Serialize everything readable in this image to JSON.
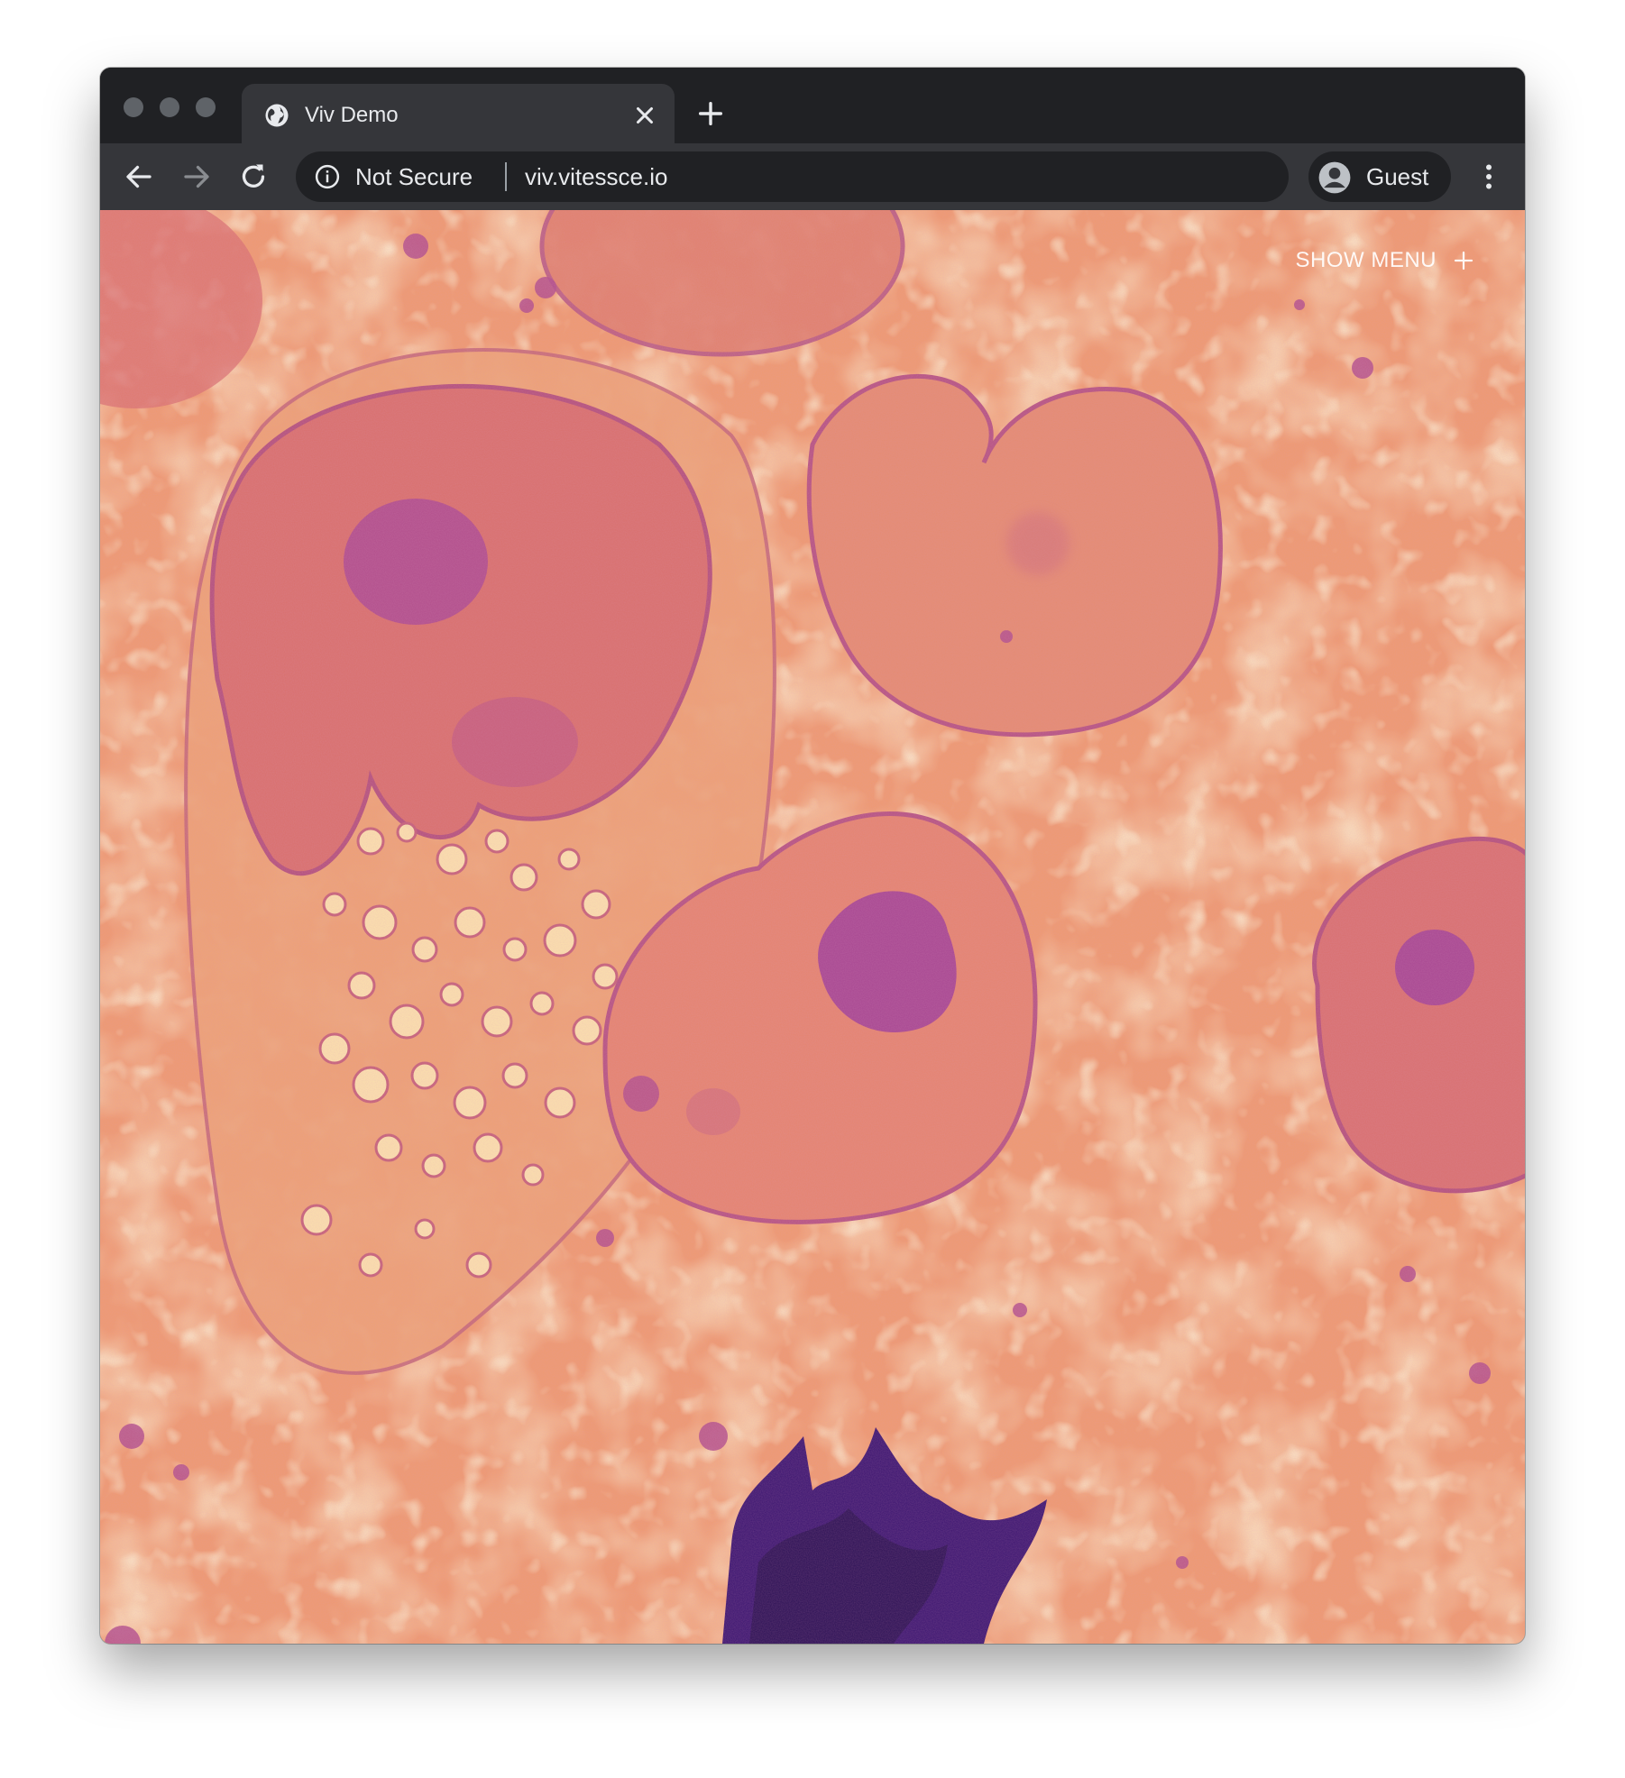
{
  "browser": {
    "tab": {
      "title": "Viv Demo"
    },
    "address_bar": {
      "security_label": "Not Secure",
      "url": "viv.vitessce.io"
    },
    "profile": {
      "label": "Guest"
    }
  },
  "viewer": {
    "menu_toggle_label": "SHOW MENU",
    "colormap_colors": {
      "background": "#f0a070",
      "light": "#fde2a0",
      "mid": "#e7776a",
      "dark": "#b3478a",
      "darkest": "#3b1670"
    }
  }
}
